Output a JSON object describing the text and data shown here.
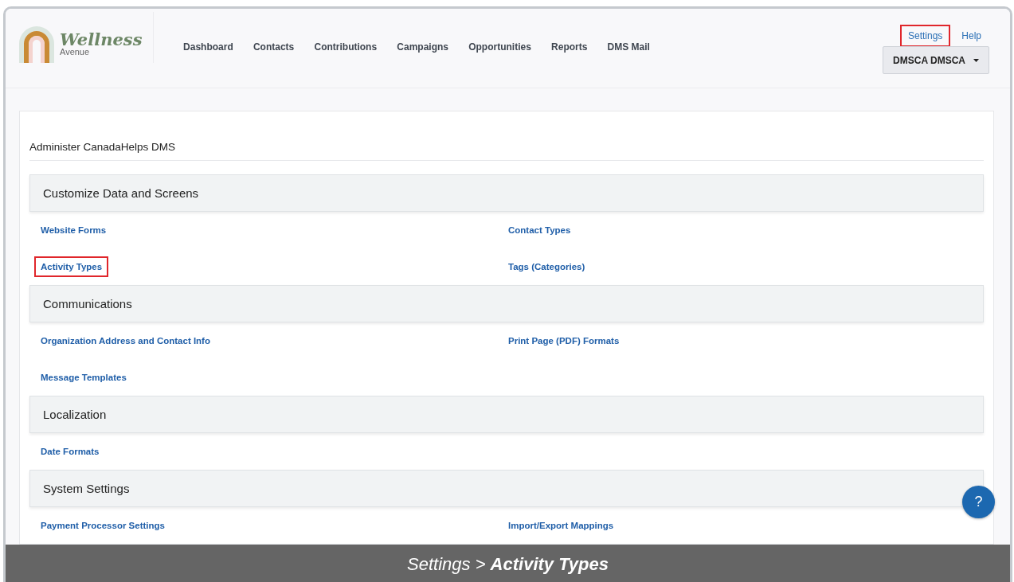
{
  "header": {
    "logo": {
      "name": "Wellness",
      "tagline": "Avenue"
    },
    "nav": [
      {
        "label": "Dashboard"
      },
      {
        "label": "Contacts"
      },
      {
        "label": "Contributions"
      },
      {
        "label": "Campaigns"
      },
      {
        "label": "Opportunities"
      },
      {
        "label": "Reports"
      },
      {
        "label": "DMS Mail"
      }
    ],
    "top_links": [
      {
        "label": "Settings",
        "highlighted": true
      },
      {
        "label": "Help",
        "highlighted": false
      }
    ],
    "user_menu": {
      "label": "DMSCA DMSCA"
    }
  },
  "page_title": "Administer CanadaHelps DMS",
  "sections": [
    {
      "title": "Customize Data and Screens",
      "links": [
        {
          "label": "Website Forms",
          "highlighted": false
        },
        {
          "label": "Contact Types",
          "highlighted": false
        },
        {
          "label": "Activity Types",
          "highlighted": true
        },
        {
          "label": "Tags (Categories)",
          "highlighted": false
        }
      ]
    },
    {
      "title": "Communications",
      "links": [
        {
          "label": "Organization Address and Contact Info",
          "highlighted": false
        },
        {
          "label": "Print Page (PDF) Formats",
          "highlighted": false
        },
        {
          "label": "Message Templates",
          "highlighted": false
        }
      ]
    },
    {
      "title": "Localization",
      "links": [
        {
          "label": "Date Formats",
          "highlighted": false
        }
      ]
    },
    {
      "title": "System Settings",
      "links": [
        {
          "label": "Payment Processor Settings",
          "highlighted": false
        },
        {
          "label": "Import/Export Mappings",
          "highlighted": false
        }
      ]
    }
  ],
  "help_button": {
    "label": "?"
  },
  "caption": "Settings > **Activity Types**"
}
